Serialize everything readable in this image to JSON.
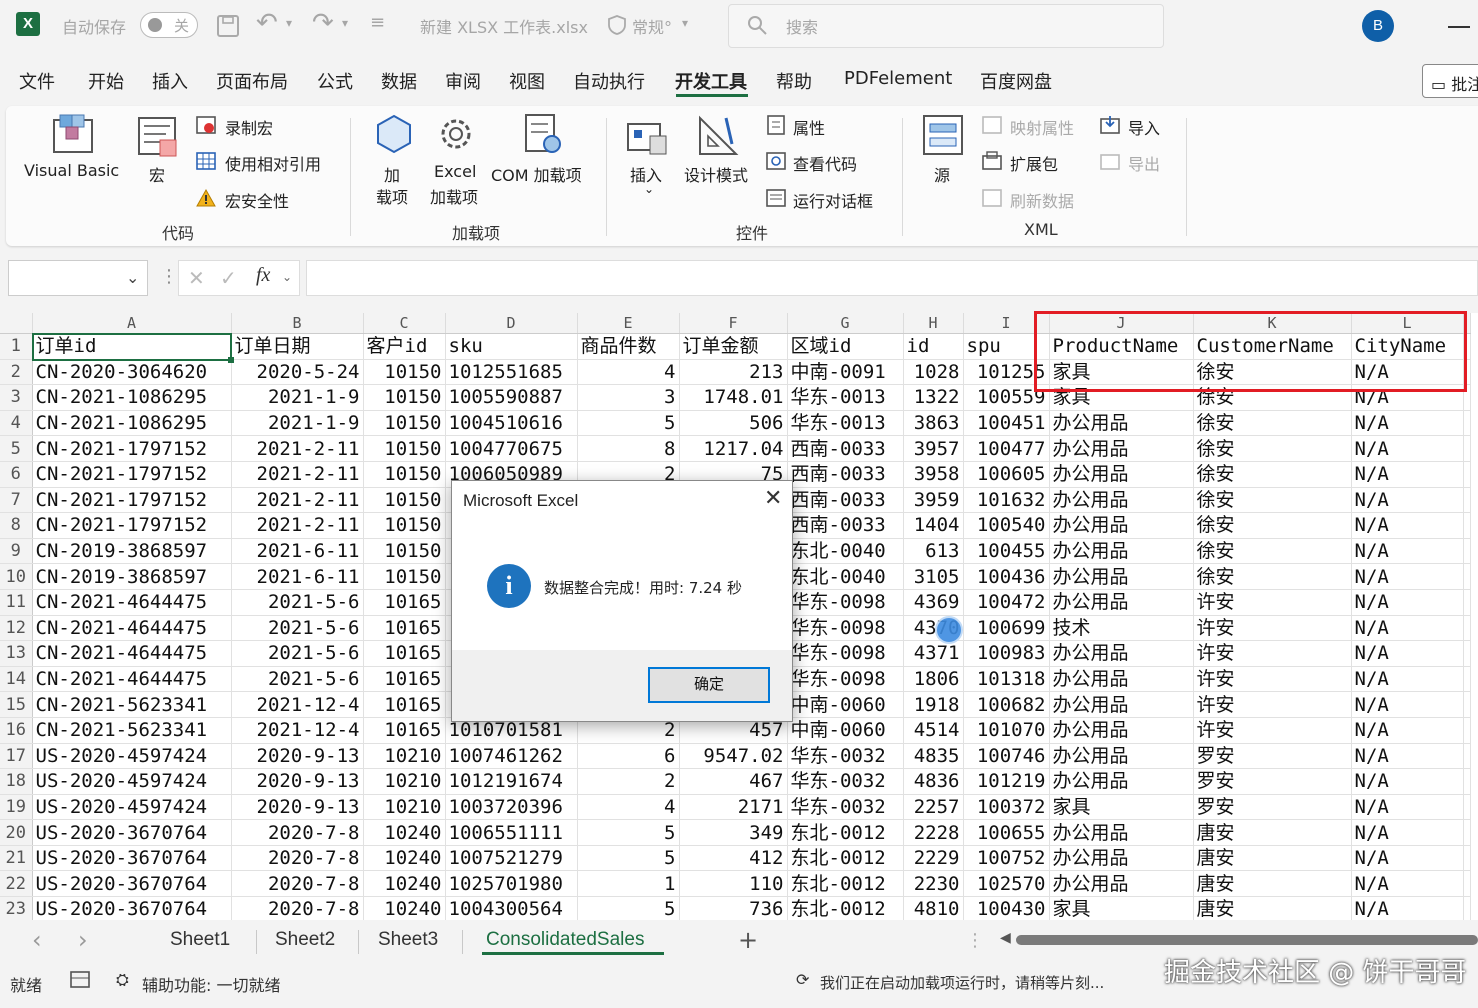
{
  "titlebar": {
    "autosave_label": "自动保存",
    "autosave_state": "关",
    "undo": "↶",
    "redo": "↷",
    "filename": "新建 XLSX 工作表.xlsx",
    "sensitivity": "常规°",
    "search_placeholder": "搜索",
    "avatar_initial": "B"
  },
  "menu": {
    "tabs": [
      "文件",
      "开始",
      "插入",
      "页面布局",
      "公式",
      "数据",
      "审阅",
      "视图",
      "自动执行",
      "开发工具",
      "帮助",
      "PDFelement",
      "百度网盘"
    ],
    "active": "开发工具",
    "comment_button": "批注"
  },
  "ribbon": {
    "code": {
      "visual_basic": "Visual Basic",
      "macros": "宏",
      "record_macro": "录制宏",
      "relative_ref": "使用相对引用",
      "macro_security": "宏安全性",
      "group": "代码"
    },
    "addins": {
      "addins_line1": "加",
      "addins_line2": "载项",
      "excel_line1": "Excel",
      "excel_line2": "加载项",
      "com": "COM 加载项",
      "group": "加载项"
    },
    "controls": {
      "insert": "插入",
      "design_mode": "设计模式",
      "properties": "属性",
      "view_code": "查看代码",
      "run_dialog": "运行对话框",
      "group": "控件"
    },
    "xml": {
      "source": "源",
      "map_props": "映射属性",
      "expansion": "扩展包",
      "refresh": "刷新数据",
      "import": "导入",
      "export": "导出",
      "group": "XML"
    }
  },
  "formula_bar": {
    "namebox_value": "",
    "fx": "fx",
    "content": ""
  },
  "grid": {
    "columns": [
      "A",
      "B",
      "C",
      "D",
      "E",
      "F",
      "G",
      "H",
      "I",
      "J",
      "K",
      "L"
    ],
    "header_row": [
      "订单id",
      "订单日期",
      "客户id",
      "sku",
      "商品件数",
      "订单金额",
      "区域id",
      "id",
      "spu",
      "ProductName",
      "CustomerName",
      "CityName"
    ],
    "rows": [
      [
        "CN-2020-3064620",
        "2020-5-24",
        "10150",
        "1012551685",
        "4",
        "213",
        "中南-0091",
        "1028",
        "101255",
        "家具",
        "徐安",
        "N/A"
      ],
      [
        "CN-2021-1086295",
        "2021-1-9",
        "10150",
        "1005590887",
        "3",
        "1748.01",
        "华东-0013",
        "1322",
        "100559",
        "家具",
        "徐安",
        "N/A"
      ],
      [
        "CN-2021-1086295",
        "2021-1-9",
        "10150",
        "1004510616",
        "5",
        "506",
        "华东-0013",
        "3863",
        "100451",
        "办公用品",
        "徐安",
        "N/A"
      ],
      [
        "CN-2021-1797152",
        "2021-2-11",
        "10150",
        "1004770675",
        "8",
        "1217.04",
        "西南-0033",
        "3957",
        "100477",
        "办公用品",
        "徐安",
        "N/A"
      ],
      [
        "CN-2021-1797152",
        "2021-2-11",
        "10150",
        "1006050989",
        "2",
        "75",
        "西南-0033",
        "3958",
        "100605",
        "办公用品",
        "徐安",
        "N/A"
      ],
      [
        "CN-2021-1797152",
        "2021-2-11",
        "10150",
        "",
        "",
        "",
        "西南-0033",
        "3959",
        "101632",
        "办公用品",
        "徐安",
        "N/A"
      ],
      [
        "CN-2021-1797152",
        "2021-2-11",
        "10150",
        "",
        "",
        "",
        "西南-0033",
        "1404",
        "100540",
        "办公用品",
        "徐安",
        "N/A"
      ],
      [
        "CN-2019-3868597",
        "2021-6-11",
        "10150",
        "",
        "",
        "",
        "东北-0040",
        "613",
        "100455",
        "办公用品",
        "徐安",
        "N/A"
      ],
      [
        "CN-2019-3868597",
        "2021-6-11",
        "10150",
        "",
        "",
        "",
        "东北-0040",
        "3105",
        "100436",
        "办公用品",
        "徐安",
        "N/A"
      ],
      [
        "CN-2021-4644475",
        "2021-5-6",
        "10165",
        "",
        "",
        "",
        "华东-0098",
        "4369",
        "100472",
        "办公用品",
        "许安",
        "N/A"
      ],
      [
        "CN-2021-4644475",
        "2021-5-6",
        "10165",
        "",
        "",
        "",
        "华东-0098",
        "4370",
        "100699",
        "技术",
        "许安",
        "N/A"
      ],
      [
        "CN-2021-4644475",
        "2021-5-6",
        "10165",
        "",
        "",
        "",
        "华东-0098",
        "4371",
        "100983",
        "办公用品",
        "许安",
        "N/A"
      ],
      [
        "CN-2021-4644475",
        "2021-5-6",
        "10165",
        "",
        "",
        "",
        "华东-0098",
        "1806",
        "101318",
        "办公用品",
        "许安",
        "N/A"
      ],
      [
        "CN-2021-5623341",
        "2021-12-4",
        "10165",
        "",
        "",
        "",
        "中南-0060",
        "1918",
        "100682",
        "办公用品",
        "许安",
        "N/A"
      ],
      [
        "CN-2021-5623341",
        "2021-12-4",
        "10165",
        "1010701581",
        "2",
        "457",
        "中南-0060",
        "4514",
        "101070",
        "办公用品",
        "许安",
        "N/A"
      ],
      [
        "US-2020-4597424",
        "2020-9-13",
        "10210",
        "1007461262",
        "6",
        "9547.02",
        "华东-0032",
        "4835",
        "100746",
        "办公用品",
        "罗安",
        "N/A"
      ],
      [
        "US-2020-4597424",
        "2020-9-13",
        "10210",
        "1012191674",
        "2",
        "467",
        "华东-0032",
        "4836",
        "101219",
        "办公用品",
        "罗安",
        "N/A"
      ],
      [
        "US-2020-4597424",
        "2020-9-13",
        "10210",
        "1003720396",
        "4",
        "2171",
        "华东-0032",
        "2257",
        "100372",
        "家具",
        "罗安",
        "N/A"
      ],
      [
        "US-2020-3670764",
        "2020-7-8",
        "10240",
        "1006551111",
        "5",
        "349",
        "东北-0012",
        "2228",
        "100655",
        "办公用品",
        "唐安",
        "N/A"
      ],
      [
        "US-2020-3670764",
        "2020-7-8",
        "10240",
        "1007521279",
        "5",
        "412",
        "东北-0012",
        "2229",
        "100752",
        "办公用品",
        "唐安",
        "N/A"
      ],
      [
        "US-2020-3670764",
        "2020-7-8",
        "10240",
        "1025701980",
        "1",
        "110",
        "东北-0012",
        "2230",
        "102570",
        "办公用品",
        "唐安",
        "N/A"
      ],
      [
        "US-2020-3670764",
        "2020-7-8",
        "10240",
        "1004300564",
        "5",
        "736",
        "东北-0012",
        "4810",
        "100430",
        "家具",
        "唐安",
        "N/A"
      ]
    ]
  },
  "dialog": {
    "title": "Microsoft Excel",
    "close": "✕",
    "info_icon": "i",
    "message": "数据整合完成！用时: 7.24 秒",
    "ok": "确定"
  },
  "sheets": {
    "nav_prev": "‹",
    "nav_next": "›",
    "tabs": [
      "Sheet1",
      "Sheet2",
      "Sheet3",
      "ConsolidatedSales"
    ],
    "active": "ConsolidatedSales",
    "add": "+"
  },
  "status": {
    "ready": "就绪",
    "accessibility": "辅助功能: 一切就绪",
    "loading": "我们正在启动加载项运行时，请稍等片刻...",
    "watermark": "掘金技术社区 @ 饼干哥哥"
  },
  "colors": {
    "excel_green": "#1d6f42",
    "highlight_red": "#e21c24",
    "dialog_accent": "#0078d7",
    "info_blue": "#1e73be"
  }
}
